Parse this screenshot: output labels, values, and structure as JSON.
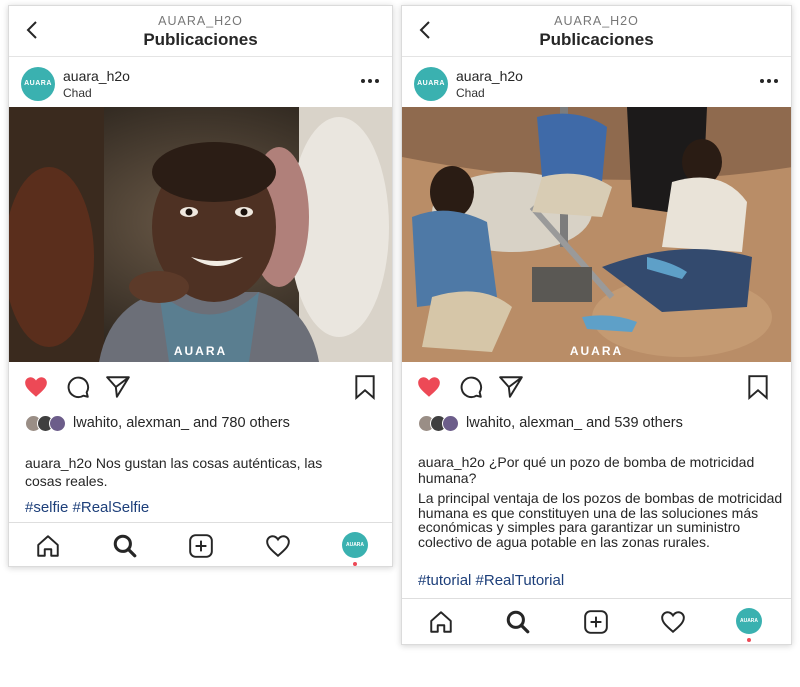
{
  "posts": [
    {
      "header": {
        "account": "AUARA_H2O",
        "title": "Publicaciones"
      },
      "author": {
        "username": "auara_h2o",
        "location": "Chad",
        "avatar_text": "AUARA"
      },
      "photo": {
        "watermark": "AUARA",
        "icon": "smiling-child-photo"
      },
      "liked": true,
      "likes_text": "lwahito, alexman_ and 780 others",
      "caption": {
        "username": "auara_h2o",
        "text": "Nos gustan las cosas auténticas, las cosas reales.",
        "body": ""
      },
      "hashtags": "#selfie #RealSelfie",
      "tab_avatar_text": "AUARA"
    },
    {
      "header": {
        "account": "AUARA_H2O",
        "title": "Publicaciones"
      },
      "author": {
        "username": "auara_h2o",
        "location": "Chad",
        "avatar_text": "AUARA"
      },
      "photo": {
        "watermark": "AUARA",
        "icon": "well-pump-workers-photo"
      },
      "liked": true,
      "likes_text": "lwahito, alexman_ and 539 others",
      "caption": {
        "username": "auara_h2o",
        "text": "¿Por qué un pozo de bomba de motricidad humana?",
        "body": "La principal ventaja de los pozos de bombas de motricidad humana es que constituyen una de las soluciones más económicas y simples para garantizar un suministro colectivo de agua potable en las zonas rurales."
      },
      "hashtags": "#tutorial #RealTutorial",
      "tab_avatar_text": "AUARA"
    }
  ],
  "colors": {
    "brand": "#3ab1b0",
    "like": "#ed4956",
    "hashtag": "#1d3f7a"
  }
}
